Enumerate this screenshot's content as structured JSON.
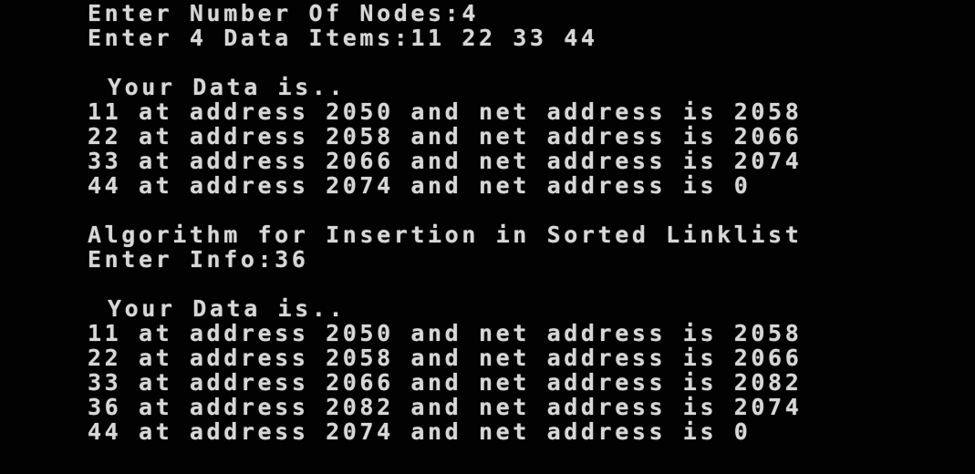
{
  "console": {
    "lines": [
      "Enter Number Of Nodes:4",
      "Enter 4 Data Items:11 22 33 44",
      "",
      "Your Data is..",
      "11 at address 2050 and net address is 2058",
      "22 at address 2058 and net address is 2066",
      "33 at address 2066 and net address is 2074",
      "44 at address 2074 and net address is 0",
      "",
      "Algorithm for Insertion in Sorted Linklist",
      "Enter Info:36",
      "",
      "Your Data is..",
      "11 at address 2050 and net address is 2058",
      "22 at address 2058 and net address is 2066",
      "33 at address 2066 and net address is 2082",
      "36 at address 2082 and net address is 2074",
      "44 at address 2074 and net address is 0"
    ]
  }
}
